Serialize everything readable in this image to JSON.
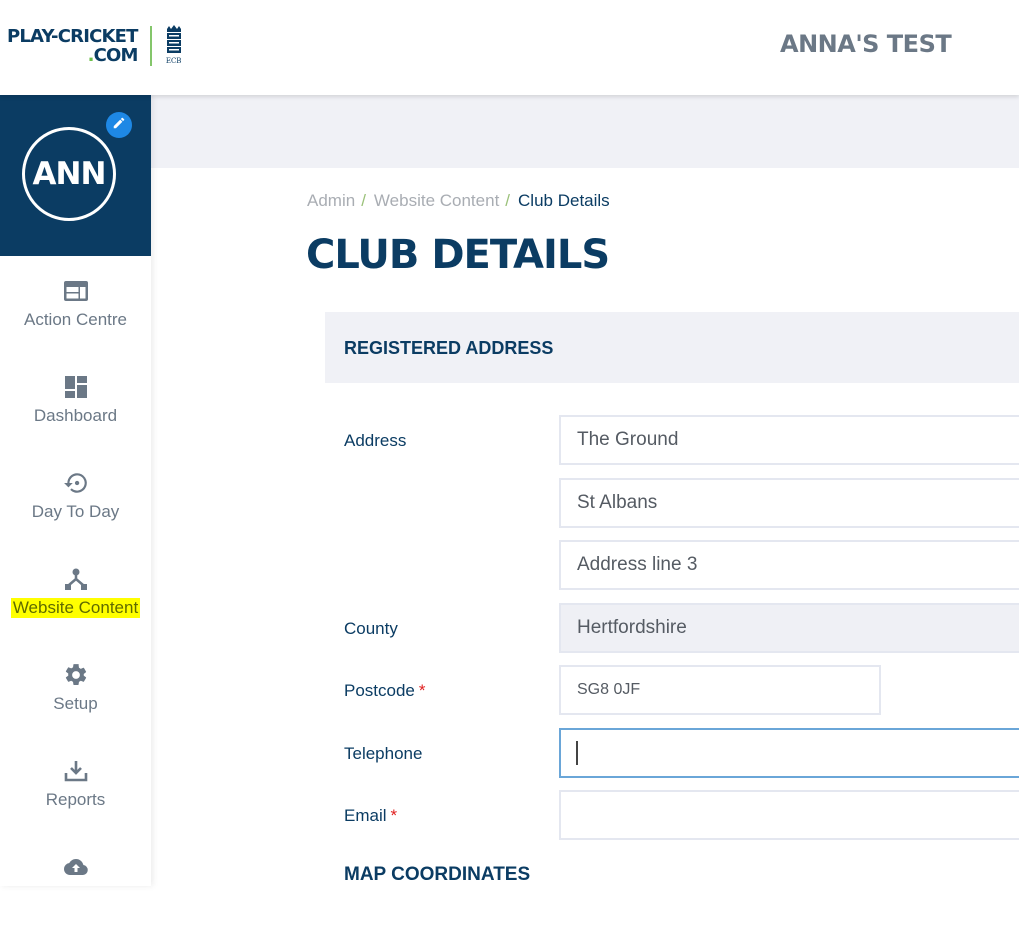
{
  "header": {
    "logo_line1": "PLAY-CRICKET",
    "logo_line2_dot": ".",
    "logo_line2": "COM",
    "ecb_label": "ECB",
    "club_name": "ANNA'S TEST"
  },
  "profile": {
    "initials": "ANN",
    "edit_icon": "pencil-icon"
  },
  "sidebar": {
    "items": [
      {
        "label": "Action Centre",
        "icon": "action-centre-icon"
      },
      {
        "label": "Dashboard",
        "icon": "dashboard-icon"
      },
      {
        "label": "Day To Day",
        "icon": "history-icon"
      },
      {
        "label": "Website Content",
        "icon": "hierarchy-icon",
        "active": true
      },
      {
        "label": "Setup",
        "icon": "gear-icon"
      },
      {
        "label": "Reports",
        "icon": "download-icon"
      },
      {
        "label": "",
        "icon": "cloud-upload-icon"
      }
    ]
  },
  "breadcrumb": {
    "items": [
      "Admin",
      "Website Content",
      "Club Details"
    ],
    "separator": "/"
  },
  "page_title": "CLUB DETAILS",
  "registered_address": {
    "title": "REGISTERED ADDRESS",
    "fields": {
      "address_label": "Address",
      "address_line1": "The Ground",
      "address_line2": "St Albans",
      "address_line3": "Address line 3",
      "county_label": "County",
      "county": "Hertfordshire",
      "postcode_label": "Postcode",
      "postcode": "SG8 0JF",
      "telephone_label": "Telephone",
      "telephone": "",
      "email_label": "Email",
      "email": "",
      "required_marker": "*"
    }
  },
  "map_coordinates": {
    "title": "MAP COORDINATES"
  },
  "colors": {
    "brand_navy": "#0b3c63",
    "brand_green": "#6cbf4a",
    "accent_blue": "#1e88e5",
    "highlight": "#ffff00",
    "required": "#e02020"
  }
}
